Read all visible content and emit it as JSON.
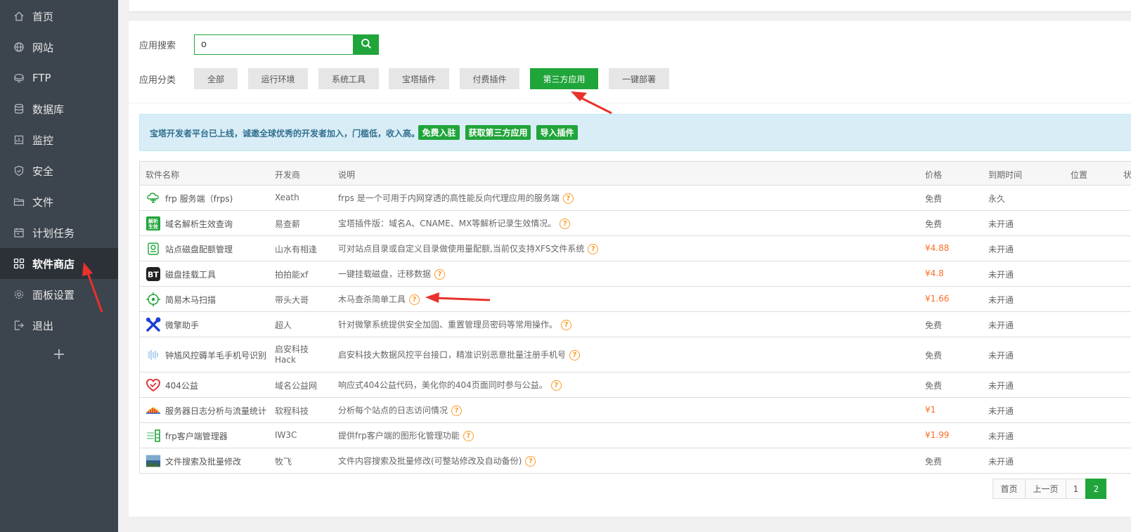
{
  "sidebar": {
    "items": [
      {
        "label": "首页",
        "icon": "home-icon"
      },
      {
        "label": "网站",
        "icon": "globe-icon"
      },
      {
        "label": "FTP",
        "icon": "ftp-icon"
      },
      {
        "label": "数据库",
        "icon": "database-icon"
      },
      {
        "label": "监控",
        "icon": "monitor-icon"
      },
      {
        "label": "安全",
        "icon": "shield-icon"
      },
      {
        "label": "文件",
        "icon": "folder-icon"
      },
      {
        "label": "计划任务",
        "icon": "calendar-icon"
      },
      {
        "label": "软件商店",
        "icon": "apps-grid-icon"
      },
      {
        "label": "面板设置",
        "icon": "gear-icon"
      },
      {
        "label": "退出",
        "icon": "logout-icon"
      }
    ],
    "plus": "+"
  },
  "search": {
    "label": "应用搜索",
    "value": "o"
  },
  "categories": {
    "label": "应用分类",
    "items": [
      "全部",
      "运行环境",
      "系统工具",
      "宝塔插件",
      "付费插件",
      "第三方应用",
      "一键部署"
    ],
    "active": "第三方应用"
  },
  "notice": {
    "text": "宝塔开发者平台已上线，诚邀全球优秀的开发者加入，门槛低，收入高。",
    "buttons": [
      "免费入驻",
      "获取第三方应用",
      "导入插件"
    ]
  },
  "table": {
    "headers": [
      "软件名称",
      "开发商",
      "说明",
      "价格",
      "到期时间",
      "位置",
      "状"
    ],
    "rows": [
      {
        "name": "frp 服务端（frps)",
        "dev": "Xeath",
        "desc": "frps 是一个可用于内网穿透的高性能反向代理应用的服务端",
        "price": "免费",
        "expiry": "永久",
        "icon": "cloud-server-icon"
      },
      {
        "name": "域名解析生效查询",
        "dev": "易查薪",
        "desc": "宝塔插件版：域名A、CNAME、MX等解析记录生效情况。",
        "price": "免费",
        "expiry": "未开通",
        "icon": "dns-check-icon"
      },
      {
        "name": "站点磁盘配额管理",
        "dev": "山水有相逢",
        "desc": "可对站点目录或自定义目录做使用量配额,当前仅支持XFS文件系统",
        "price": "¥4.88",
        "expiry": "未开通",
        "icon": "disk-quota-icon"
      },
      {
        "name": "磁盘挂载工具",
        "dev": "拍拍能xf",
        "desc": "一键挂载磁盘，迁移数据",
        "price": "¥4.8",
        "expiry": "未开通",
        "icon": "bt-logo-icon"
      },
      {
        "name": "简易木马扫描",
        "dev": "带头大哥",
        "desc": "木马查杀简单工具",
        "price": "¥1.66",
        "expiry": "未开通",
        "icon": "target-icon"
      },
      {
        "name": "微擎助手",
        "dev": "超人",
        "desc": "针对微擎系统提供安全加固、重置管理员密码等常用操作。",
        "price": "免费",
        "expiry": "未开通",
        "icon": "tools-icon"
      },
      {
        "name": "钟馗风控薅羊毛手机号识别",
        "dev": "启安科技Hack",
        "devLines": [
          "启安科技",
          "Hack"
        ],
        "desc": "启安科技大数据风控平台接口，精准识别恶意批量注册手机号",
        "price": "免费",
        "expiry": "未开通",
        "icon": "signal-icon"
      },
      {
        "name": "404公益",
        "dev": "域名公益网",
        "desc": "响应式404公益代码，美化你的404页面同时参与公益。",
        "price": "免费",
        "expiry": "未开通",
        "icon": "heart-icon"
      },
      {
        "name": "服务器日志分析与流量统计",
        "dev": "软程科技",
        "desc": "分析每个站点的日志访问情况",
        "price": "¥1",
        "expiry": "未开通",
        "icon": "chart-icon"
      },
      {
        "name": "frp客户端管理器",
        "dev": "IW3C",
        "desc": "提供frp客户端的图形化管理功能",
        "price": "¥1.99",
        "expiry": "未开通",
        "icon": "bars-icon"
      },
      {
        "name": "文件搜索及批量修改",
        "dev": "牧飞",
        "desc": "文件内容搜索及批量修改(可整站修改及自动备份)",
        "price": "免费",
        "expiry": "未开通",
        "icon": "landscape-icon"
      }
    ]
  },
  "pagination": {
    "items": [
      "首页",
      "上一页",
      "1",
      "2"
    ],
    "active": "2"
  },
  "colors": {
    "accent": "#20a53a",
    "sidebar": "#3c444d",
    "price_paid": "#fc6d26",
    "arrow": "#e8322c"
  }
}
